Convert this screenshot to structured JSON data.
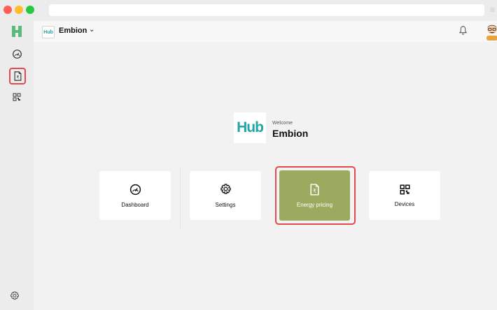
{
  "colors": {
    "accent": "#9aab5f",
    "highlight": "#e5484d",
    "brand": "#22a6a3",
    "close": "#ff5f57",
    "minimize": "#febc2e",
    "maximize": "#28c840"
  },
  "window": {
    "controls": [
      "close",
      "minimize",
      "maximize"
    ],
    "menu_icon": "hamburger-icon"
  },
  "sidebar": {
    "logo": "H",
    "items": [
      {
        "name": "dashboard",
        "icon": "speedometer-icon",
        "active": false
      },
      {
        "name": "energy-pricing",
        "icon": "invoice-icon",
        "active": true
      },
      {
        "name": "devices",
        "icon": "qr-grid-icon",
        "active": false
      }
    ],
    "settings_icon": "gear-icon"
  },
  "topbar": {
    "org_logo": "Hub",
    "org_name": "Embion",
    "org_chevron": "⌄",
    "bell_icon": "bell-icon",
    "avatar": "user-avatar"
  },
  "hero": {
    "logo_text": "Hub",
    "welcome": "Welcome",
    "company": "Embion"
  },
  "cards": [
    {
      "label": "Dashboard",
      "icon": "speedometer-icon",
      "selected": false
    },
    {
      "label": "Settings",
      "icon": "gear-icon",
      "selected": false
    },
    {
      "label": "Energy pricing",
      "icon": "invoice-icon",
      "selected": true
    },
    {
      "label": "Devices",
      "icon": "qr-grid-icon",
      "selected": false
    }
  ]
}
